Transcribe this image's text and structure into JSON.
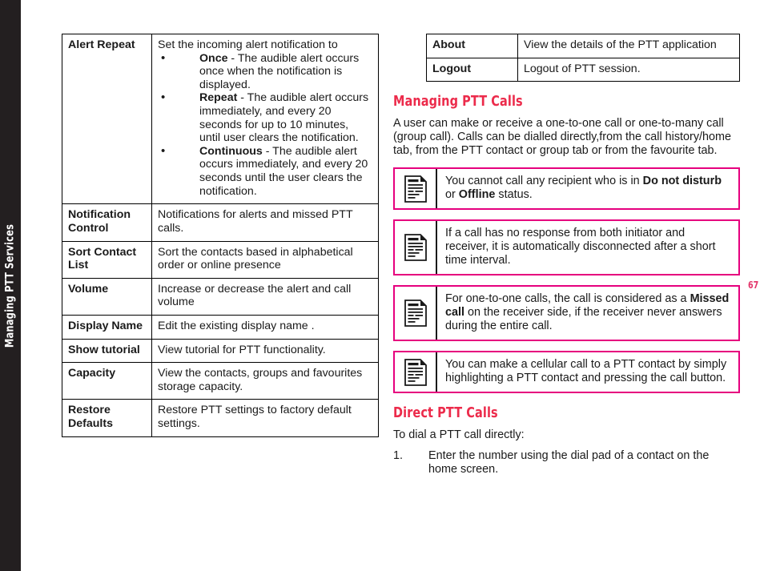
{
  "spine": {
    "running_head": "Managing PTT Services"
  },
  "page_number": "67",
  "left_column": {
    "settings_table": {
      "rows": [
        {
          "key": "Alert Repeat",
          "intro": "Set the incoming alert notification to",
          "bullets": [
            {
              "term": "Once",
              "text": " - The audible alert occurs once when the notification is displayed."
            },
            {
              "term": "Repeat",
              "text": " - The audible alert occurs immediately, and every 20 seconds for up to 10 minutes, until user clears the notification."
            },
            {
              "term": "Continuous",
              "text": " - The audible alert occurs immediately, and every 20 seconds until the user clears the notification."
            }
          ]
        },
        {
          "key": "Notification Control",
          "value": "Notifications for alerts and missed PTT calls."
        },
        {
          "key": "Sort Contact List",
          "value": "Sort the contacts based in alphabetical order or online presence"
        },
        {
          "key": "Volume",
          "value": "Increase or decrease the alert and call volume"
        },
        {
          "key": "Display Name",
          "value": "Edit the existing display name ."
        },
        {
          "key": "Show tutorial",
          "value": "View tutorial for PTT functionality."
        },
        {
          "key": "Capacity",
          "value": "View the contacts, groups and favourites storage capacity."
        },
        {
          "key": "Restore Defaults",
          "value": "Restore PTT settings to factory default settings."
        }
      ]
    }
  },
  "right_column": {
    "about_table": {
      "rows": [
        {
          "key": "About",
          "value": "View the details of the PTT application"
        },
        {
          "key": "Logout",
          "value": "Logout of PTT session."
        }
      ]
    },
    "managing_calls": {
      "heading": "Managing PTT Calls",
      "paragraph": "A user can make or receive a one-to-one call or one-to-many call (group call). Calls can be dialled directly,from the call history/home tab, from the PTT contact or group tab or from the favourite tab."
    },
    "notes": [
      {
        "icon": "note-document-icon",
        "segments": [
          {
            "text": "You cannot call any recipient who is in ",
            "bold": false
          },
          {
            "text": "Do not disturb",
            "bold": true
          },
          {
            "text": " or ",
            "bold": false
          },
          {
            "text": "Offline",
            "bold": true
          },
          {
            "text": " status.",
            "bold": false
          }
        ]
      },
      {
        "icon": "note-document-icon",
        "segments": [
          {
            "text": "If a call has no response from both initiator and receiver, it is automatically disconnected after a short time interval.",
            "bold": false
          }
        ]
      },
      {
        "icon": "note-document-icon",
        "segments": [
          {
            "text": "For one-to-one calls, the call is considered as a ",
            "bold": false
          },
          {
            "text": "Missed call",
            "bold": true
          },
          {
            "text": " on the receiver side, if the receiver never answers during the entire call.",
            "bold": false
          }
        ]
      },
      {
        "icon": "note-document-icon",
        "segments": [
          {
            "text": "You can make a cellular call to a PTT contact by simply highlighting a PTT contact and pressing the call button.",
            "bold": false
          }
        ]
      }
    ],
    "direct_calls": {
      "heading": "Direct PTT Calls",
      "lead_in": "To dial a PTT call directly:",
      "steps": [
        {
          "num": "1.",
          "text": "Enter the number using the dial pad of a contact on the home screen."
        }
      ]
    }
  },
  "colors": {
    "heading_red": "#ec2b4b",
    "note_border_pink": "#e6007e",
    "spine_dark": "#231f20",
    "page_number_pink": "#e3356b",
    "body_text": "#1a1a1a"
  }
}
